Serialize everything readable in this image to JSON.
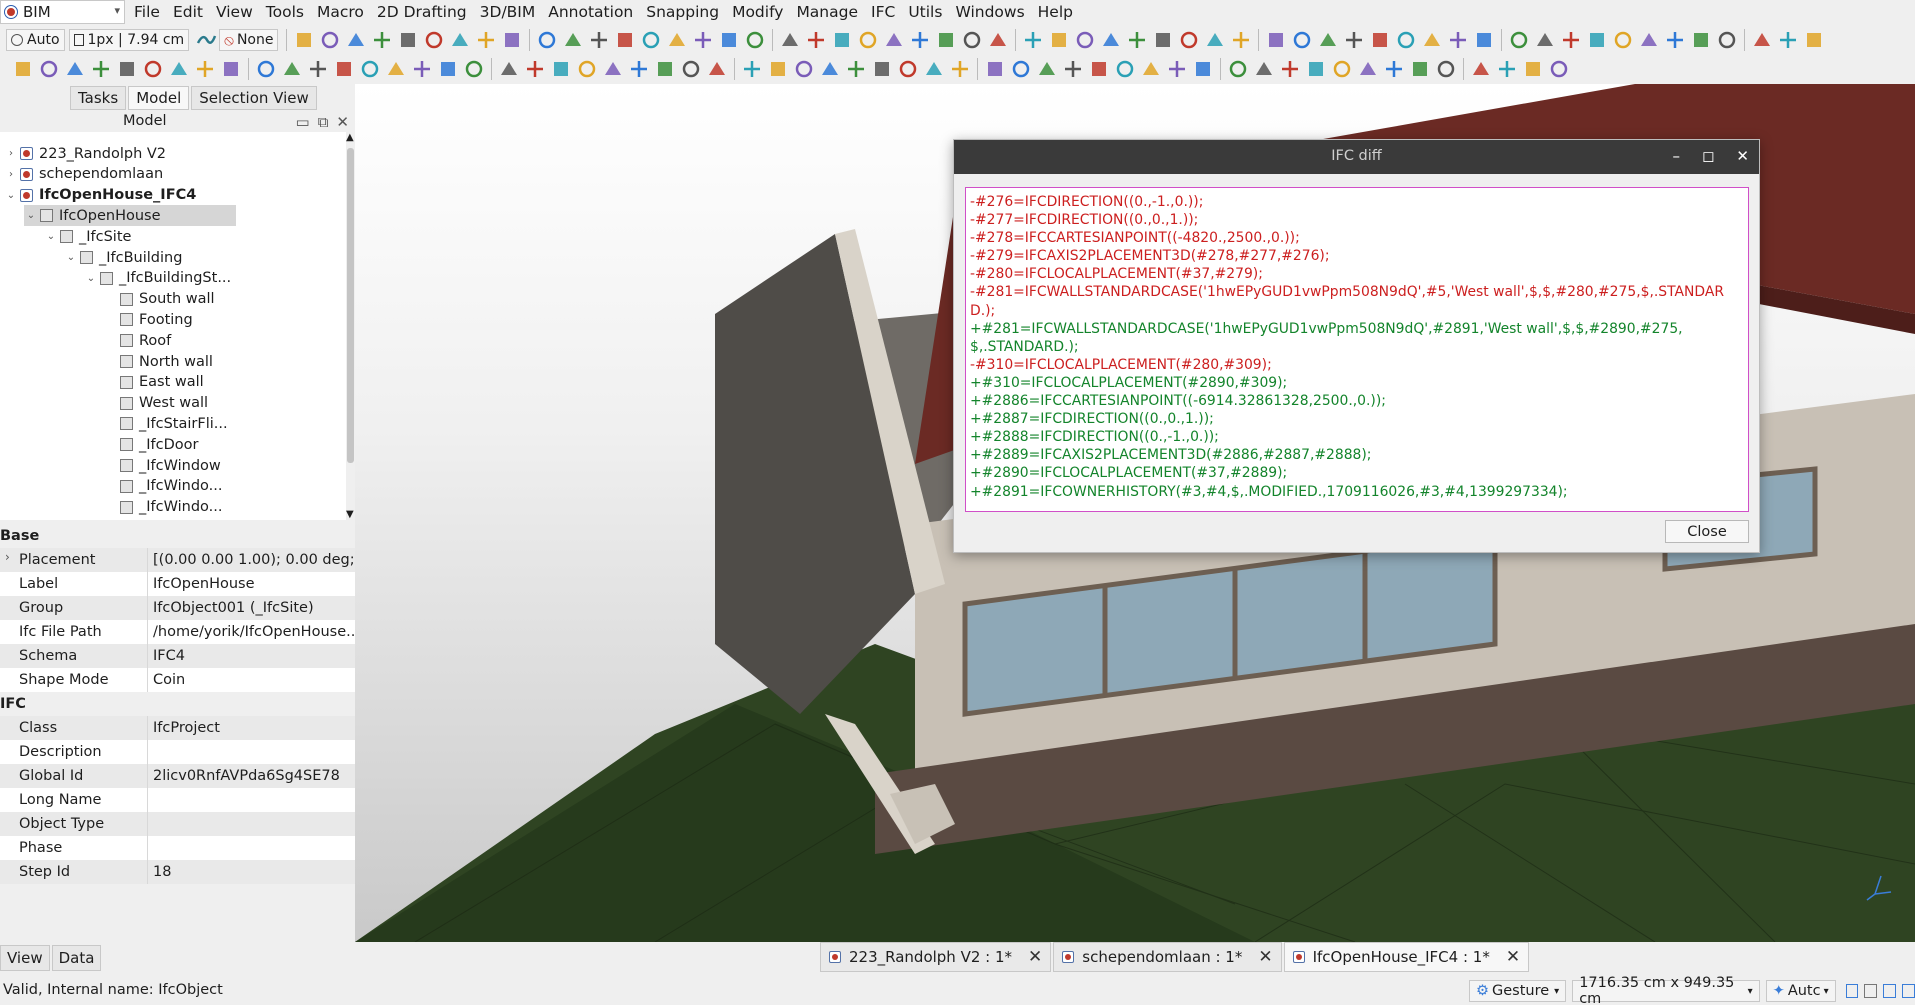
{
  "workbench": {
    "name": "BIM"
  },
  "menu": [
    "File",
    "Edit",
    "View",
    "Tools",
    "Macro",
    "2D Drafting",
    "3D/BIM",
    "Annotation",
    "Snapping",
    "Modify",
    "Manage",
    "IFC",
    "Utils",
    "Windows",
    "Help"
  ],
  "toolbar": {
    "auto_label": "Auto",
    "linewidth_label": "1px | 7.94 cm",
    "none_label": "None"
  },
  "panel_tabs": [
    "Tasks",
    "Model",
    "Selection View"
  ],
  "model_panel": {
    "title": "Model"
  },
  "tree": [
    {
      "label": "223_Randolph V2",
      "level": 0,
      "expander": "›",
      "type": "doc",
      "selected": false
    },
    {
      "label": "schependomlaan",
      "level": 0,
      "expander": "›",
      "type": "doc",
      "selected": false
    },
    {
      "label": "IfcOpenHouse_IFC4",
      "level": 0,
      "expander": "⌄",
      "type": "doc",
      "selected": false
    },
    {
      "label": "IfcOpenHouse",
      "level": 1,
      "expander": "⌄",
      "type": "obj",
      "selected": true
    },
    {
      "label": "_IfcSite",
      "level": 2,
      "expander": "⌄",
      "type": "obj",
      "selected": false
    },
    {
      "label": "_IfcBuilding",
      "level": 3,
      "expander": "⌄",
      "type": "obj",
      "selected": false
    },
    {
      "label": "_IfcBuildingSt...",
      "level": 4,
      "expander": "⌄",
      "type": "obj",
      "selected": false
    },
    {
      "label": "South wall",
      "level": 5,
      "expander": "",
      "type": "obj",
      "selected": false
    },
    {
      "label": "Footing",
      "level": 5,
      "expander": "",
      "type": "obj",
      "selected": false
    },
    {
      "label": "Roof",
      "level": 5,
      "expander": "",
      "type": "obj",
      "selected": false
    },
    {
      "label": "North wall",
      "level": 5,
      "expander": "",
      "type": "obj",
      "selected": false
    },
    {
      "label": "East wall",
      "level": 5,
      "expander": "",
      "type": "obj",
      "selected": false
    },
    {
      "label": "West wall",
      "level": 5,
      "expander": "",
      "type": "obj",
      "selected": false
    },
    {
      "label": "_IfcStairFli...",
      "level": 5,
      "expander": "",
      "type": "obj",
      "selected": false
    },
    {
      "label": "_IfcDoor",
      "level": 5,
      "expander": "",
      "type": "obj",
      "selected": false
    },
    {
      "label": "_IfcWindow",
      "level": 5,
      "expander": "",
      "type": "obj",
      "selected": false
    },
    {
      "label": "_IfcWindo...",
      "level": 5,
      "expander": "",
      "type": "obj",
      "selected": false
    },
    {
      "label": "_IfcWindo...",
      "level": 5,
      "expander": "",
      "type": "obj",
      "selected": false
    }
  ],
  "properties": {
    "groups": [
      {
        "name": "Base",
        "rows": [
          {
            "key": "Placement",
            "value": "[(0.00 0.00 1.00); 0.00 deg;...",
            "expandable": true
          },
          {
            "key": "Label",
            "value": "IfcOpenHouse"
          },
          {
            "key": "Group",
            "value": "IfcObject001 (_IfcSite)"
          },
          {
            "key": "Ifc File Path",
            "value": "/home/yorik/IfcOpenHouse..."
          },
          {
            "key": "Schema",
            "value": "IFC4"
          },
          {
            "key": "Shape Mode",
            "value": "Coin"
          }
        ]
      },
      {
        "name": "IFC",
        "rows": [
          {
            "key": "Class",
            "value": "IfcProject"
          },
          {
            "key": "Description",
            "value": ""
          },
          {
            "key": "Global Id",
            "value": "2licv0RnfAVPda6Sg4SE78"
          },
          {
            "key": "Long Name",
            "value": ""
          },
          {
            "key": "Object Type",
            "value": ""
          },
          {
            "key": "Phase",
            "value": ""
          },
          {
            "key": "Step Id",
            "value": "18"
          }
        ]
      }
    ]
  },
  "bottom_tabs": [
    "View",
    "Data"
  ],
  "status": {
    "text": "Valid, Internal name: IfcObject",
    "nav_style": "Gesture",
    "dimensions": "1716.35 cm x 949.35 cm",
    "units": "Autc"
  },
  "doc_tabs": [
    {
      "label": "223_Randolph V2 : 1*",
      "active": false
    },
    {
      "label": "schependomlaan : 1*",
      "active": false
    },
    {
      "label": "IfcOpenHouse_IFC4 : 1*",
      "active": true
    }
  ],
  "dialog": {
    "title": "IFC diff",
    "close_label": "Close",
    "lines": [
      {
        "t": "-#276=IFCDIRECTION((0.,-1.,0.));",
        "k": "rm"
      },
      {
        "t": "-#277=IFCDIRECTION((0.,0.,1.));",
        "k": "rm"
      },
      {
        "t": "-#278=IFCCARTESIANPOINT((-4820.,2500.,0.));",
        "k": "rm"
      },
      {
        "t": "-#279=IFCAXIS2PLACEMENT3D(#278,#277,#276);",
        "k": "rm"
      },
      {
        "t": "-#280=IFCLOCALPLACEMENT(#37,#279);",
        "k": "rm"
      },
      {
        "t": "-#281=IFCWALLSTANDARDCASE('1hwEPyGUD1vwPpm508N9dQ',#5,'West wall',$,$,#280,#275,$,.STANDARD.);",
        "k": "rm"
      },
      {
        "t": "+#281=IFCWALLSTANDARDCASE('1hwEPyGUD1vwPpm508N9dQ',#2891,'West wall',$,$,#2890,#275,\n$,.STANDARD.);",
        "k": "ad"
      },
      {
        "t": "-#310=IFCLOCALPLACEMENT(#280,#309);",
        "k": "rm"
      },
      {
        "t": "+#310=IFCLOCALPLACEMENT(#2890,#309);",
        "k": "ad"
      },
      {
        "t": "+#2886=IFCCARTESIANPOINT((-6914.32861328,2500.,0.));",
        "k": "ad"
      },
      {
        "t": "+#2887=IFCDIRECTION((0.,0.,1.));",
        "k": "ad"
      },
      {
        "t": "+#2888=IFCDIRECTION((0.,-1.,0.));",
        "k": "ad"
      },
      {
        "t": "+#2889=IFCAXIS2PLACEMENT3D(#2886,#2887,#2888);",
        "k": "ad"
      },
      {
        "t": "+#2890=IFCLOCALPLACEMENT(#37,#2889);",
        "k": "ad"
      },
      {
        "t": "+#2891=IFCOWNERHISTORY(#3,#4,$,.MODIFIED.,1709116026,#3,#4,1399297334);",
        "k": "ad"
      }
    ]
  },
  "colors": {
    "removed": "#cc1f1f",
    "added": "#13842b",
    "roof": "#6b2a24",
    "ground": "#2f4422",
    "wall": "#cfc7bc",
    "glass": "#8ea8b7"
  }
}
